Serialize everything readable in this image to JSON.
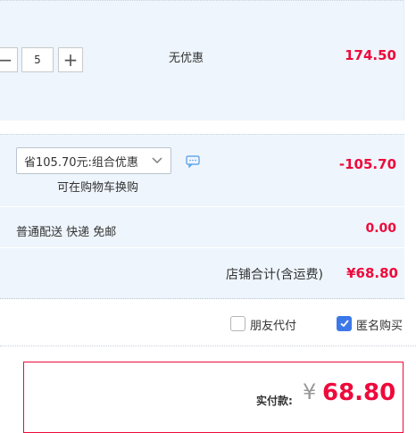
{
  "item": {
    "quantity": "5",
    "discount_label": "无优惠",
    "price": "174.50"
  },
  "promo": {
    "select_text": "省105.70元:组合优惠",
    "hint": "可在购物车换购",
    "discount": "-105.70"
  },
  "shipping": {
    "label": "普通配送 快递 免邮",
    "cost": "0.00"
  },
  "shop_total": {
    "label": "店铺合计(含运费)",
    "value": "¥68.80"
  },
  "options": {
    "friend_pay_label": "朋友代付",
    "friend_pay_checked": false,
    "anonymous_label": "匿名购买",
    "anonymous_checked": true
  },
  "payment": {
    "label": "实付款:",
    "currency": "¥",
    "amount": "68.80"
  },
  "colors": {
    "price_red": "#ee0a3b",
    "band_bg": "#eef5fc",
    "checkbox_blue": "#3c78e8"
  }
}
